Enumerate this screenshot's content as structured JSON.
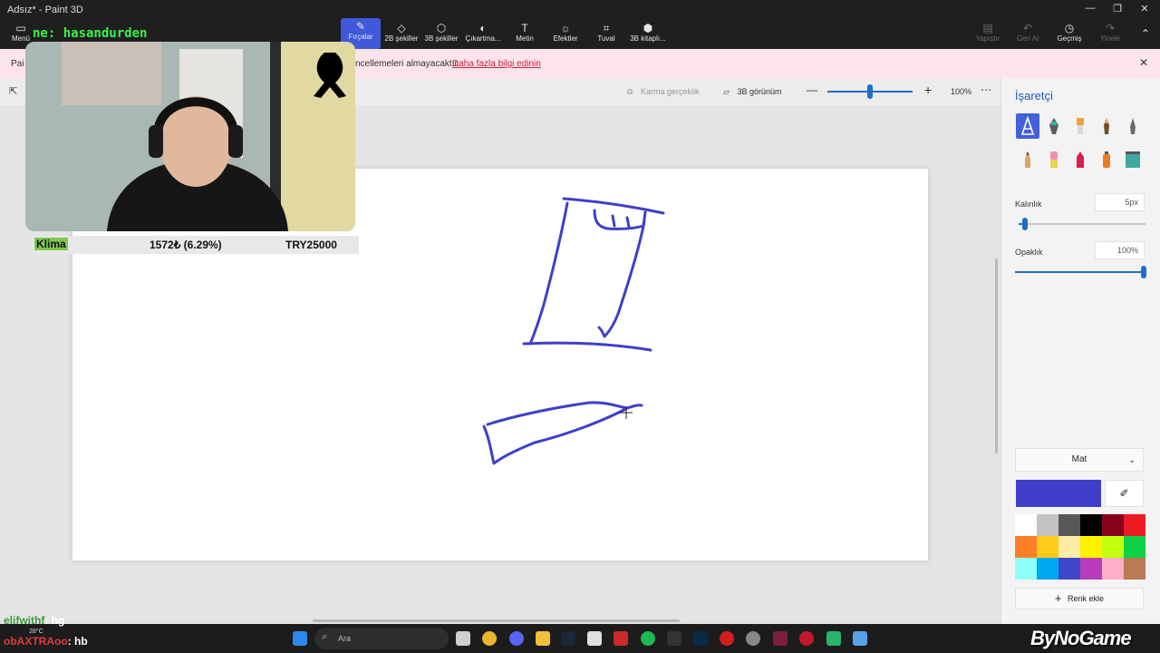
{
  "app": {
    "title": "Adsız* - Paint 3D"
  },
  "toolbar": {
    "menu": "Menü",
    "tools": [
      "Fırçalar",
      "2B şekiller",
      "3B şekiller",
      "Çıkartma...",
      "Metin",
      "Efektler",
      "Tuval",
      "3B kitaplı..."
    ],
    "active_tool": "Fırçalar",
    "undo": "Yapıştır",
    "paste": "Geri Al",
    "history": "Geçmiş",
    "redo": "Yinele"
  },
  "notification": {
    "prefix": "Pai",
    "message": "ncellemeleri almayacaktır.",
    "link": "Daha fazla bilgi edinin"
  },
  "subbar": {
    "mixed_reality": "Karma gerçeklik",
    "view3d": "3B görünüm",
    "zoom": "100%"
  },
  "panel": {
    "title": "İşaretçi",
    "thickness_label": "Kalınlık",
    "thickness_value": "5px",
    "thickness_fraction": 0.05,
    "opacity_label": "Opaklık",
    "opacity_value": "100%",
    "opacity_fraction": 1.0,
    "finish": "Mat",
    "current_color": "#3f3fc9",
    "add_color": "Renk ekle",
    "palette": [
      "#ffffff",
      "#c3c3c3",
      "#585858",
      "#000000",
      "#88001b",
      "#ec1c24",
      "#ff7f27",
      "#ffca18",
      "#fdeca6",
      "#fff200",
      "#c4ff0e",
      "#0ed145",
      "#8cfffb",
      "#00a8f3",
      "#3f48cc",
      "#b83dba",
      "#ffaec8",
      "#b97a56"
    ]
  },
  "overlay": {
    "streamer": "ne: hasandurden",
    "bar_item": "Klima",
    "bar_price": "1572₺ (6.29%)",
    "bar_goal": "TRY25000",
    "chat": [
      {
        "user": "elifwithf",
        "message": ": hg"
      },
      {
        "user": "obAXTRAoo",
        "message": ": hb"
      }
    ],
    "watermark": "ByNoGame"
  },
  "taskbar": {
    "search_placeholder": "Ara",
    "weather": "28°C"
  }
}
